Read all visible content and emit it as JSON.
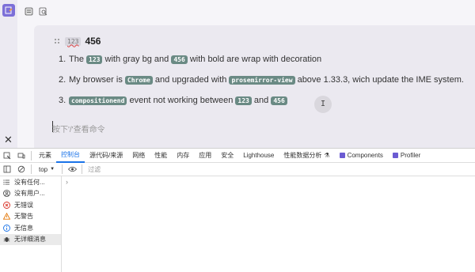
{
  "editor": {
    "heading_tag": "123",
    "heading_text": "456",
    "items": [
      {
        "num": "1.",
        "parts": [
          {
            "t": "The "
          },
          {
            "code": "123"
          },
          {
            "t": " with gray bg and "
          },
          {
            "code": "456"
          },
          {
            "t": " with bold are wrap with decoration"
          }
        ]
      },
      {
        "num": "2.",
        "parts": [
          {
            "t": "My browser is "
          },
          {
            "code": "Chrome"
          },
          {
            "t": " and upgraded with "
          },
          {
            "code": "prosemirror-view"
          },
          {
            "t": " above 1.33.3, wich update the IME system."
          }
        ]
      },
      {
        "num": "3.",
        "parts": [
          {
            "code": "compositionend"
          },
          {
            "t": " event not working between "
          },
          {
            "code": "123"
          },
          {
            "t": " and "
          },
          {
            "code": "456"
          }
        ]
      }
    ],
    "placeholder": "按下'/'查看命令"
  },
  "devtools": {
    "tabs": [
      "元素",
      "控制台",
      "源代码/来源",
      "网络",
      "性能",
      "内存",
      "应用",
      "安全",
      "Lighthouse",
      "性能数据分析",
      "Components",
      "Profiler"
    ],
    "active_tab": "控制台",
    "context": "top",
    "filter_placeholder": "过滤",
    "sidebar": [
      {
        "label": "没有任何...",
        "icon": "list-icon"
      },
      {
        "label": "没有用户...",
        "icon": "user-icon"
      },
      {
        "label": "无错误",
        "icon": "error-icon"
      },
      {
        "label": "无警告",
        "icon": "warning-icon"
      },
      {
        "label": "无信息",
        "icon": "info-icon"
      },
      {
        "label": "无详细消息",
        "icon": "bug-icon"
      }
    ],
    "prompt_chevron": "›"
  },
  "colors": {
    "accent": "#7c6fd8",
    "code_bg": "#6a8a84",
    "devtools_active": "#1a73e8"
  }
}
